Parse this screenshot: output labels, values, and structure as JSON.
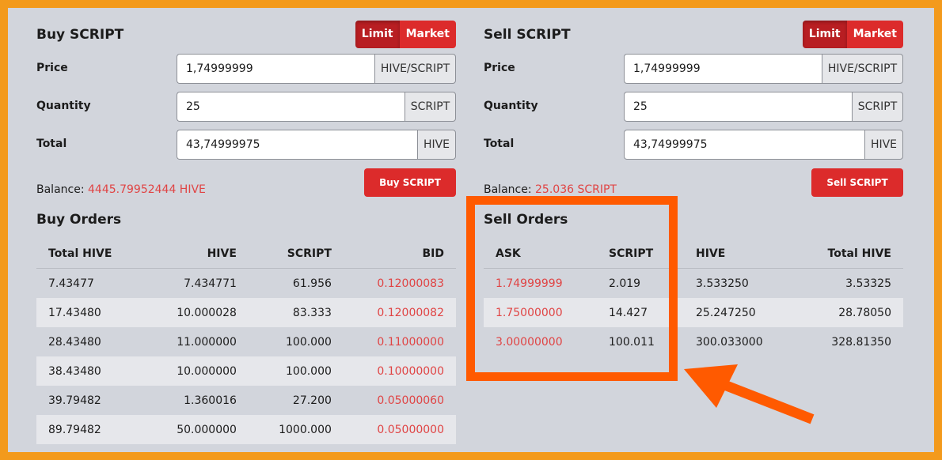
{
  "buy": {
    "title": "Buy SCRIPT",
    "toggle": {
      "limit": "Limit",
      "market": "Market"
    },
    "price": {
      "label": "Price",
      "value": "1,74999999",
      "unit": "HIVE/SCRIPT"
    },
    "quantity": {
      "label": "Quantity",
      "value": "25",
      "unit": "SCRIPT"
    },
    "total": {
      "label": "Total",
      "value": "43,74999975",
      "unit": "HIVE"
    },
    "balance_label": "Balance:",
    "balance_value": "4445.79952444 HIVE",
    "button": "Buy SCRIPT"
  },
  "sell": {
    "title": "Sell SCRIPT",
    "toggle": {
      "limit": "Limit",
      "market": "Market"
    },
    "price": {
      "label": "Price",
      "value": "1,74999999",
      "unit": "HIVE/SCRIPT"
    },
    "quantity": {
      "label": "Quantity",
      "value": "25",
      "unit": "SCRIPT"
    },
    "total": {
      "label": "Total",
      "value": "43,74999975",
      "unit": "HIVE"
    },
    "balance_label": "Balance:",
    "balance_value": "25.036 SCRIPT",
    "button": "Sell SCRIPT"
  },
  "buy_orders": {
    "title": "Buy Orders",
    "columns": [
      "Total HIVE",
      "HIVE",
      "SCRIPT",
      "BID"
    ],
    "rows": [
      [
        "7.43477",
        "7.434771",
        "61.956",
        "0.12000083"
      ],
      [
        "17.43480",
        "10.000028",
        "83.333",
        "0.12000082"
      ],
      [
        "28.43480",
        "11.000000",
        "100.000",
        "0.11000000"
      ],
      [
        "38.43480",
        "10.000000",
        "100.000",
        "0.10000000"
      ],
      [
        "39.79482",
        "1.360016",
        "27.200",
        "0.05000060"
      ],
      [
        "89.79482",
        "50.000000",
        "1000.000",
        "0.05000000"
      ]
    ]
  },
  "sell_orders": {
    "title": "Sell Orders",
    "columns": [
      "ASK",
      "SCRIPT",
      "HIVE",
      "Total HIVE"
    ],
    "rows": [
      [
        "1.74999999",
        "2.019",
        "3.533250",
        "3.53325"
      ],
      [
        "1.75000000",
        "14.427",
        "25.247250",
        "28.78050"
      ],
      [
        "3.00000000",
        "100.011",
        "300.033000",
        "328.81350"
      ]
    ]
  },
  "colors": {
    "accent_red": "#dc2b2b",
    "price_red": "#e04444",
    "annotation_orange": "#ff5a00",
    "outer_border": "#f39a1c",
    "panel_bg": "#d2d5dc"
  }
}
